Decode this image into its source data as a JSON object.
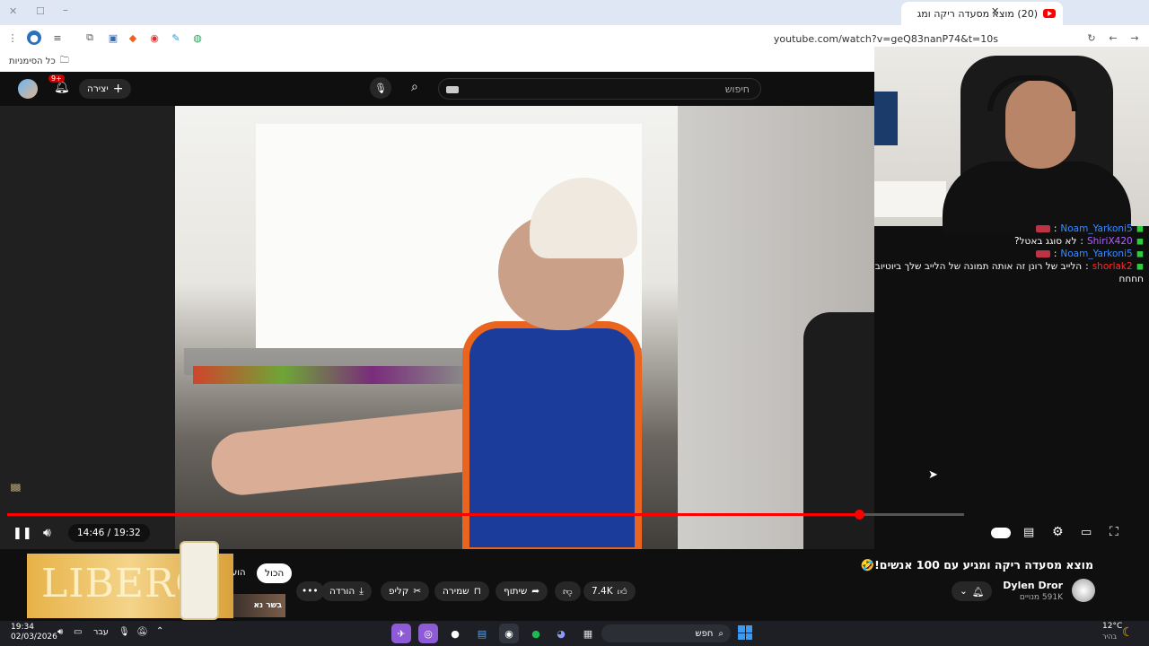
{
  "browser": {
    "tab_title": "(20) מוצא מסעדה ריקה ומג",
    "url": "youtube.com/watch?v=geQ83nanP74&t=10s",
    "bookmarks_label": "כל הסימניות"
  },
  "youtube": {
    "create_label": "יצירה",
    "notifications_badge": "9+",
    "search_placeholder": "חיפוש",
    "time_display": "14:46 / 19:32",
    "progress_fraction": 0.89,
    "video_title": "מוצא מסעדה ריקה ומגיע עם 100 אנשים!🤣",
    "channel_name": "Dylen Dror",
    "subscribers": "591K מנויים",
    "like_count": "7.4K",
    "share_label": "שיתוף",
    "save_label": "שמירה",
    "clip_label": "קליפ",
    "download_label": "הורדה",
    "filter_all": "הכול",
    "filter_partial": "הוע",
    "ad_text": "LIBERO",
    "thumb_text": "בשר נא"
  },
  "chat": [
    {
      "user": "Noam_Yarkoni5",
      "user_color": "#3a8bff",
      "msg": ""
    },
    {
      "user": "ShiriX420",
      "user_color": "#b160ff",
      "msg": "לא סוגג באטל?"
    },
    {
      "user": "Noam_Yarkoni5",
      "user_color": "#3a8bff",
      "msg": ""
    },
    {
      "user": "shorlak2",
      "user_color": "#ff2a2a",
      "msg": "הלייב של רונן זה אותה תמונה של הלייב שלך ביוטיוב"
    },
    {
      "user": "",
      "user_color": "#ffffff",
      "msg": "חחחח"
    }
  ],
  "taskbar": {
    "search_label": "חפש",
    "weather_temp": "12°C",
    "weather_desc": "בהיר",
    "lang": "עבר",
    "time": "19:34",
    "date": "02/03/2026"
  },
  "colors": {
    "progress": "#ff0000",
    "yt_bg": "#0f0f0f"
  }
}
